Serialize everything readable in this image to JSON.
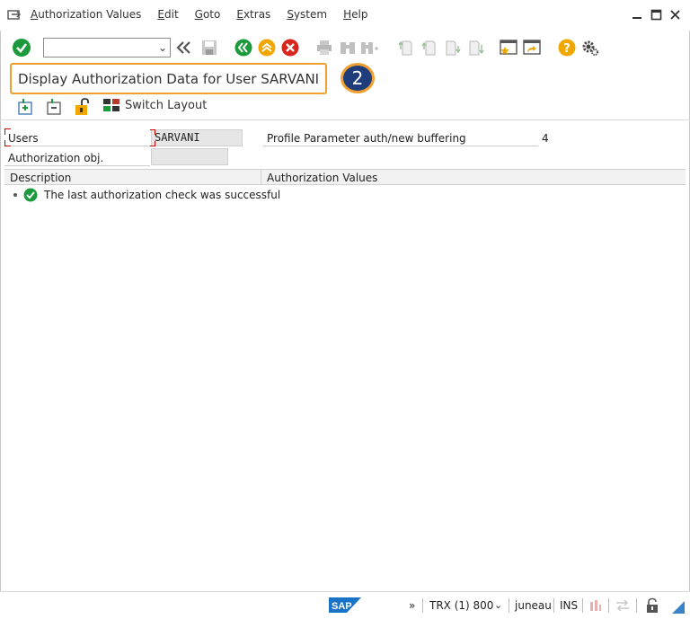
{
  "menu": {
    "items": [
      "Authorization Values",
      "Edit",
      "Goto",
      "Extras",
      "System",
      "Help"
    ]
  },
  "toolbar": {
    "command_value": "",
    "icons": [
      "enter-icon",
      "back-icon",
      "save-icon",
      "back-green-icon",
      "exit-icon",
      "cancel-icon",
      "print-icon",
      "find-icon",
      "find-next-icon",
      "first-page-icon",
      "previous-page-icon",
      "next-page-icon",
      "last-page-icon",
      "create-session-icon",
      "shortcut-icon",
      "help-icon",
      "settings-icon"
    ]
  },
  "title": {
    "text": "Display Authorization Data for User SARVANI",
    "step_badge": "2"
  },
  "app_toolbar": {
    "switch_layout_label": "Switch Layout"
  },
  "form": {
    "users_label": "Users",
    "users_value": "SARVANI",
    "auth_obj_label": "Authorization obj.",
    "auth_obj_value": "",
    "profile_param_label": "Profile Parameter auth/new buffering",
    "profile_param_value": "4"
  },
  "table": {
    "columns": [
      "Description",
      "Authorization Values"
    ],
    "rows": [
      {
        "text": "The last authorization check was successful",
        "status": "success"
      }
    ]
  },
  "statusbar": {
    "logo": "SAP",
    "expand": "»",
    "system": "TRX (1) 800",
    "server": "juneau",
    "mode": "INS"
  },
  "colors": {
    "highlight": "#f0a030",
    "badge": "#1f3d7a",
    "success": "#1a9a3a",
    "exit": "#f0a800",
    "cancel": "#d9261c"
  }
}
